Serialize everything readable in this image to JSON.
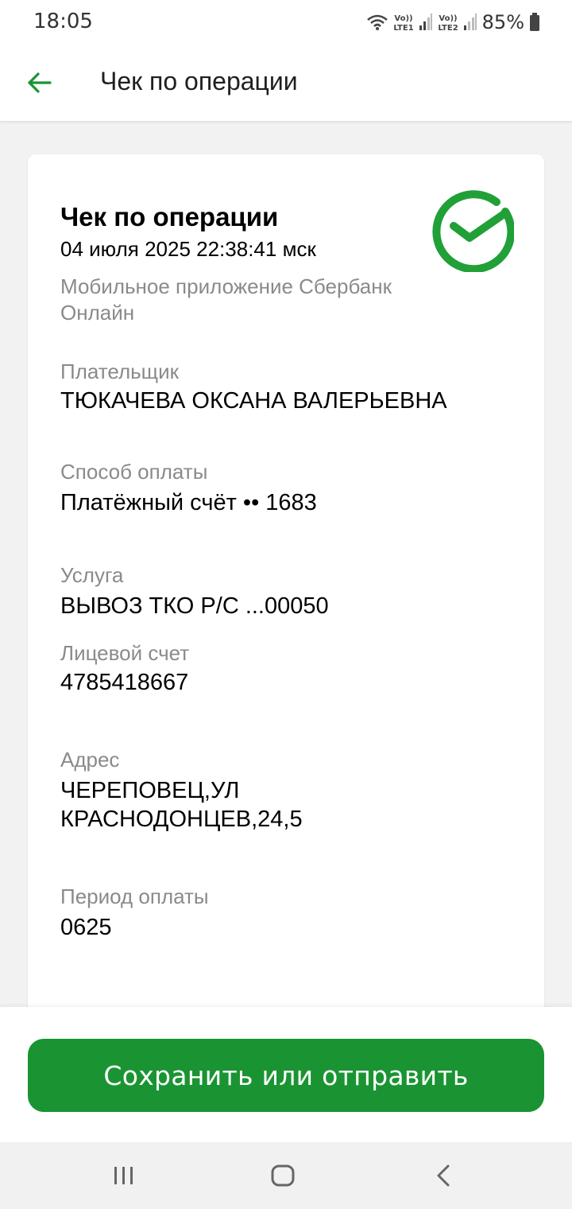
{
  "status_bar": {
    "time": "18:05",
    "battery": "85%",
    "icons": [
      "wifi-icon",
      "volte-lte1-icon",
      "signal-icon",
      "volte-lte2-icon",
      "signal-icon",
      "battery-icon"
    ]
  },
  "app_bar": {
    "title": "Чек по операции",
    "back_icon": "arrow-left-icon"
  },
  "receipt": {
    "title": "Чек по операции",
    "date": "04 июля 2025 22:38:41 мск",
    "source": "Мобильное приложение Сбербанк Онлайн",
    "logo_icon": "sber-check-logo",
    "fields": [
      {
        "label": "Плательщик",
        "value": "ТЮКАЧЕВА ОКСАНА ВАЛЕРЬЕВНА"
      },
      {
        "label": "Способ оплаты",
        "value": "Платёжный счёт •• 1683"
      },
      {
        "label": "Услуга",
        "value": "ВЫВОЗ ТКО Р/С ...00050"
      },
      {
        "label": "Лицевой счет",
        "value": "4785418667"
      },
      {
        "label": "Адрес",
        "value": "ЧЕРЕПОВЕЦ,УЛ КРАСНОДОНЦЕВ,24,5"
      },
      {
        "label": "Период оплаты",
        "value": "0625"
      }
    ]
  },
  "actions": {
    "save_label": "Сохранить или отправить"
  },
  "nav_bar": {
    "icons": [
      "recent-apps-icon",
      "home-icon",
      "back-icon"
    ]
  },
  "colors": {
    "accent": "#1a9432",
    "label_gray": "#8a8a8a"
  }
}
